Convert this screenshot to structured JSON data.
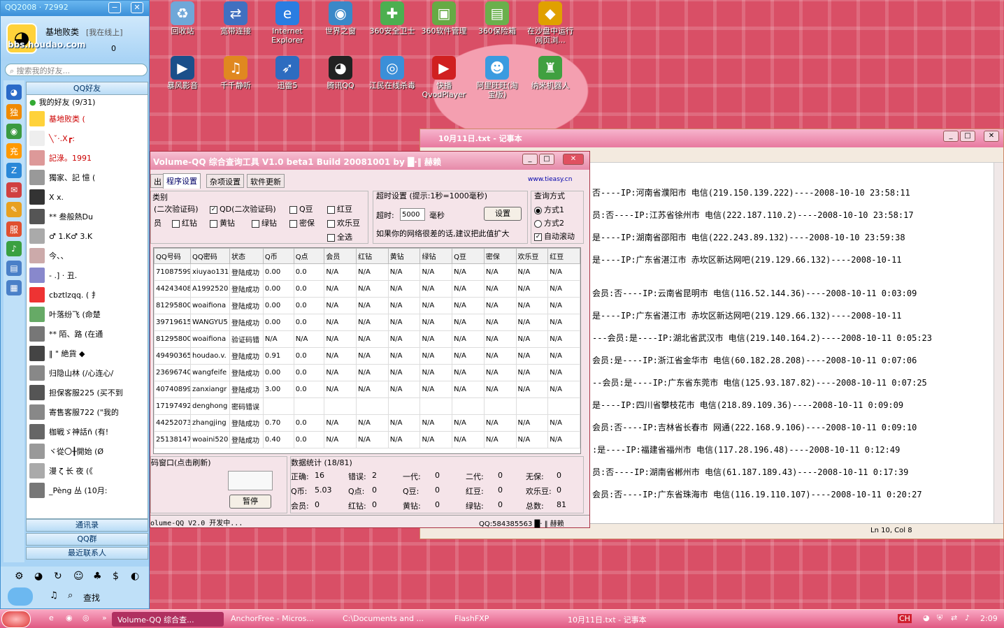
{
  "desktop_icons": [
    {
      "label": "回收站",
      "icon": "recycle-bin-icon",
      "color": "#6fa7d8",
      "glyph": "♻"
    },
    {
      "label": "宽带连接",
      "icon": "network-icon",
      "color": "#4070c0",
      "glyph": "⇄"
    },
    {
      "label": "Internet Explorer",
      "icon": "ie-icon",
      "color": "#2a7de1",
      "glyph": "e"
    },
    {
      "label": "世界之窗",
      "icon": "globe-icon",
      "color": "#3a88c8",
      "glyph": "◉"
    },
    {
      "label": "360安全卫士",
      "icon": "shield-icon",
      "color": "#4caf50",
      "glyph": "✚"
    },
    {
      "label": "360软件管理",
      "icon": "software-icon",
      "color": "#66aa44",
      "glyph": "▣"
    },
    {
      "label": "360保险箱",
      "icon": "safe-icon",
      "color": "#6ab04c",
      "glyph": "▤"
    },
    {
      "label": "在沙盘中运行网页浏...",
      "icon": "sandbox-icon",
      "color": "#e0a000",
      "glyph": "◆"
    },
    {
      "label": "暴风影音",
      "icon": "video-icon",
      "color": "#1b4f8a",
      "glyph": "▶"
    },
    {
      "label": "千千静听",
      "icon": "music-icon",
      "color": "#e08820",
      "glyph": "♫"
    },
    {
      "label": "迅雷5",
      "icon": "thunder-icon",
      "color": "#2d6cc0",
      "glyph": "➶"
    },
    {
      "label": "腾讯QQ",
      "icon": "qq-penguin-icon",
      "color": "#222222",
      "glyph": "◕"
    },
    {
      "label": "江民在线杀毒",
      "icon": "antivirus-icon",
      "color": "#3b8fd8",
      "glyph": "◎"
    },
    {
      "label": "快播 QvodPlayer",
      "icon": "player-icon",
      "color": "#d02020",
      "glyph": "▶"
    },
    {
      "label": "阿里旺旺(淘宝版)",
      "icon": "wangwang-icon",
      "color": "#3a9be0",
      "glyph": "☻"
    },
    {
      "label": "纳米机器人",
      "icon": "robot-icon",
      "color": "#40a040",
      "glyph": "♜"
    }
  ],
  "qq_panel": {
    "title": "QQ2008 · 72992",
    "watermark": "bbs.houdao.com",
    "nickname": "基地败类",
    "status": "[我在线上]",
    "counts": "0",
    "search_placeholder": "搜索我的好友...",
    "tab_friends": "QQ好友",
    "group_title": "我的好友 (9/31)",
    "friends": [
      "基地败类 (",
      "╲ˇ·.X┏:  ",
      "記淥。1991 ",
      "獨家、記 憶 (",
      "X x. ",
      "** 叁般熱Du ",
      "♂ 1.K♂ 3.K ",
      "今、、 ",
      "-  .] ·  丑. ",
      "cbztlzqq. (  扌",
      "叶落纷飞 (命楚",
      "**  陌、路 (在通",
      "‖ \" 絶貨 ◆ ",
      "归隐山林 (/心连心/",
      "担保客服225 (买不到",
      "寄售客服722 (\"我的",
      "枷戦ゞ神話ñ (有!",
      "ヾ從〇╂開始 (Ø",
      "漫 ζ 长 夜 (《",
      "_Pèng 丛 (10月:"
    ],
    "tab_contacts": "通讯录",
    "tab_groups": "QQ群",
    "tab_recent": "最近联系人",
    "search_btn": "查找"
  },
  "tool_window": {
    "title": "Volume-QQ 综合查询工具 V1.0 beta1 Build 20081001 by █·‖ 赫赖",
    "url": "www.tieasy.cn",
    "tabs": [
      "出",
      "程序设置",
      "杂项设置",
      "软件更新"
    ],
    "cat_label": "类别",
    "check_row1": [
      "(二次验证码)",
      "QD(二次验证码)",
      "Q豆",
      "红豆"
    ],
    "check_row2": [
      "员",
      "红钻",
      "黄钻",
      "绿钻",
      "密保",
      "欢乐豆"
    ],
    "check_all": "全选",
    "timeout_title": "超时设置 (提示:1秒=1000毫秒)",
    "timeout_label": "超时:",
    "timeout_value": "5000",
    "timeout_unit": "毫秒",
    "set_btn": "设置",
    "timeout_hint": "如果你的网络很差的话,建议把此值扩大",
    "mode_title": "查询方式",
    "mode1": "方式1",
    "mode2": "方式2",
    "auto_scroll": "自动滚动",
    "columns": [
      "QQ号码",
      "QQ密码",
      "状态",
      "Q币",
      "Q点",
      "会员",
      "红钻",
      "黄钻",
      "绿钻",
      "Q豆",
      "密保",
      "欢乐豆",
      "红豆"
    ],
    "rows": [
      [
        "71087599",
        "xiuyao131",
        "登陆成功",
        "0.00",
        "0.0",
        "N/A",
        "N/A",
        "N/A",
        "N/A",
        "N/A",
        "N/A",
        "N/A",
        "N/A"
      ],
      [
        "44243408",
        "A1992520",
        "登陆成功",
        "0.00",
        "0.0",
        "N/A",
        "N/A",
        "N/A",
        "N/A",
        "N/A",
        "N/A",
        "N/A",
        "N/A"
      ],
      [
        "81295800",
        "woaifiona",
        "登陆成功",
        "0.00",
        "0.0",
        "N/A",
        "N/A",
        "N/A",
        "N/A",
        "N/A",
        "N/A",
        "N/A",
        "N/A"
      ],
      [
        "39719615",
        "WANGYU5",
        "登陆成功",
        "0.00",
        "0.0",
        "N/A",
        "N/A",
        "N/A",
        "N/A",
        "N/A",
        "N/A",
        "N/A",
        "N/A"
      ],
      [
        "81295800",
        "woaifiona",
        "验证码错",
        "N/A",
        "N/A",
        "N/A",
        "N/A",
        "N/A",
        "N/A",
        "N/A",
        "N/A",
        "N/A",
        "N/A"
      ],
      [
        "49490365",
        "houdao.v.",
        "登陆成功",
        "0.91",
        "0.0",
        "N/A",
        "N/A",
        "N/A",
        "N/A",
        "N/A",
        "N/A",
        "N/A",
        "N/A"
      ],
      [
        "23696740",
        "wangfeife",
        "登陆成功",
        "0.00",
        "0.0",
        "N/A",
        "N/A",
        "N/A",
        "N/A",
        "N/A",
        "N/A",
        "N/A",
        "N/A"
      ],
      [
        "40740899",
        "zanxiangr",
        "登陆成功",
        "3.00",
        "0.0",
        "N/A",
        "N/A",
        "N/A",
        "N/A",
        "N/A",
        "N/A",
        "N/A",
        "N/A"
      ],
      [
        "17197492",
        "denghong",
        "密码错误",
        "",
        "",
        "",
        "",
        "",
        "",
        "",
        "",
        "",
        ""
      ],
      [
        "44252073",
        "zhangjing",
        "登陆成功",
        "0.70",
        "0.0",
        "N/A",
        "N/A",
        "N/A",
        "N/A",
        "N/A",
        "N/A",
        "N/A",
        "N/A"
      ],
      [
        "25138147",
        "woaini520",
        "登陆成功",
        "0.40",
        "0.0",
        "N/A",
        "N/A",
        "N/A",
        "N/A",
        "N/A",
        "N/A",
        "N/A",
        "N/A"
      ]
    ],
    "captcha_title": "码窗口(点击刷新)",
    "pause_btn": "暂停",
    "stats_title": "数据统计 (18/81)",
    "stats": [
      [
        "正确:",
        "16",
        "错误:",
        "2",
        "一代:",
        "0",
        "二代:",
        "0",
        "无保:",
        "0"
      ],
      [
        "Q币:",
        "5.03",
        "Q点:",
        "0",
        "Q豆:",
        "0",
        "红豆:",
        "0",
        "欢乐豆:",
        "0"
      ],
      [
        "会员:",
        "0",
        "红钻:",
        "0",
        "黄钻:",
        "0",
        "绿钻:",
        "0",
        "总数:",
        "81"
      ]
    ],
    "status_left": "olume-QQ V2.0 开发中...",
    "status_right": "QQ:584385563 █· ‖ 赫赖"
  },
  "notepad": {
    "title": "10月11日.txt - 记事本",
    "lines": [
      "否----IP:河南省濮阳市 电信(219.150.139.222)----2008-10-10 23:58:11",
      "员:否----IP:江苏省徐州市 电信(222.187.110.2)----2008-10-10 23:58:17",
      "是----IP:湖南省邵阳市 电信(222.243.89.132)----2008-10-10 23:59:38",
      "是----IP:广东省湛江市 赤坎区新达网吧(219.129.66.132)----2008-10-11",
      "会员:否----IP:云南省昆明市 电信(116.52.144.36)----2008-10-11 0:03:09",
      "是----IP:广东省湛江市 赤坎区新达网吧(219.129.66.132)----2008-10-11",
      "---会员:是----IP:湖北省武汉市 电信(219.140.164.2)----2008-10-11 0:05:23",
      "会员:是----IP:浙江省金华市 电信(60.182.28.208)----2008-10-11 0:07:06",
      "--会员:是----IP:广东省东莞市 电信(125.93.187.82)----2008-10-11 0:07:25",
      "是----IP:四川省攀枝花市 电信(218.89.109.36)----2008-10-11 0:09:09",
      "会员:否----IP:吉林省长春市 网通(222.168.9.106)----2008-10-11 0:09:10",
      ":是----IP:福建省福州市 电信(117.28.196.48)----2008-10-11 0:12:49",
      "员:否----IP:湖南省郴州市 电信(61.187.189.43)----2008-10-11 0:17:39",
      "会员:否----IP:广东省珠海市 电信(116.19.110.107)----2008-10-11 0:20:27"
    ],
    "status": "Ln 10, Col 8"
  },
  "taskbar": {
    "tasks": [
      "Volume-QQ 综合查...",
      "AnchorFree - Micros...",
      "C:\\Documents and ...",
      "FlashFXP",
      "10月11日.txt - 记事本"
    ],
    "lang": "CH",
    "clock": "2:09"
  }
}
